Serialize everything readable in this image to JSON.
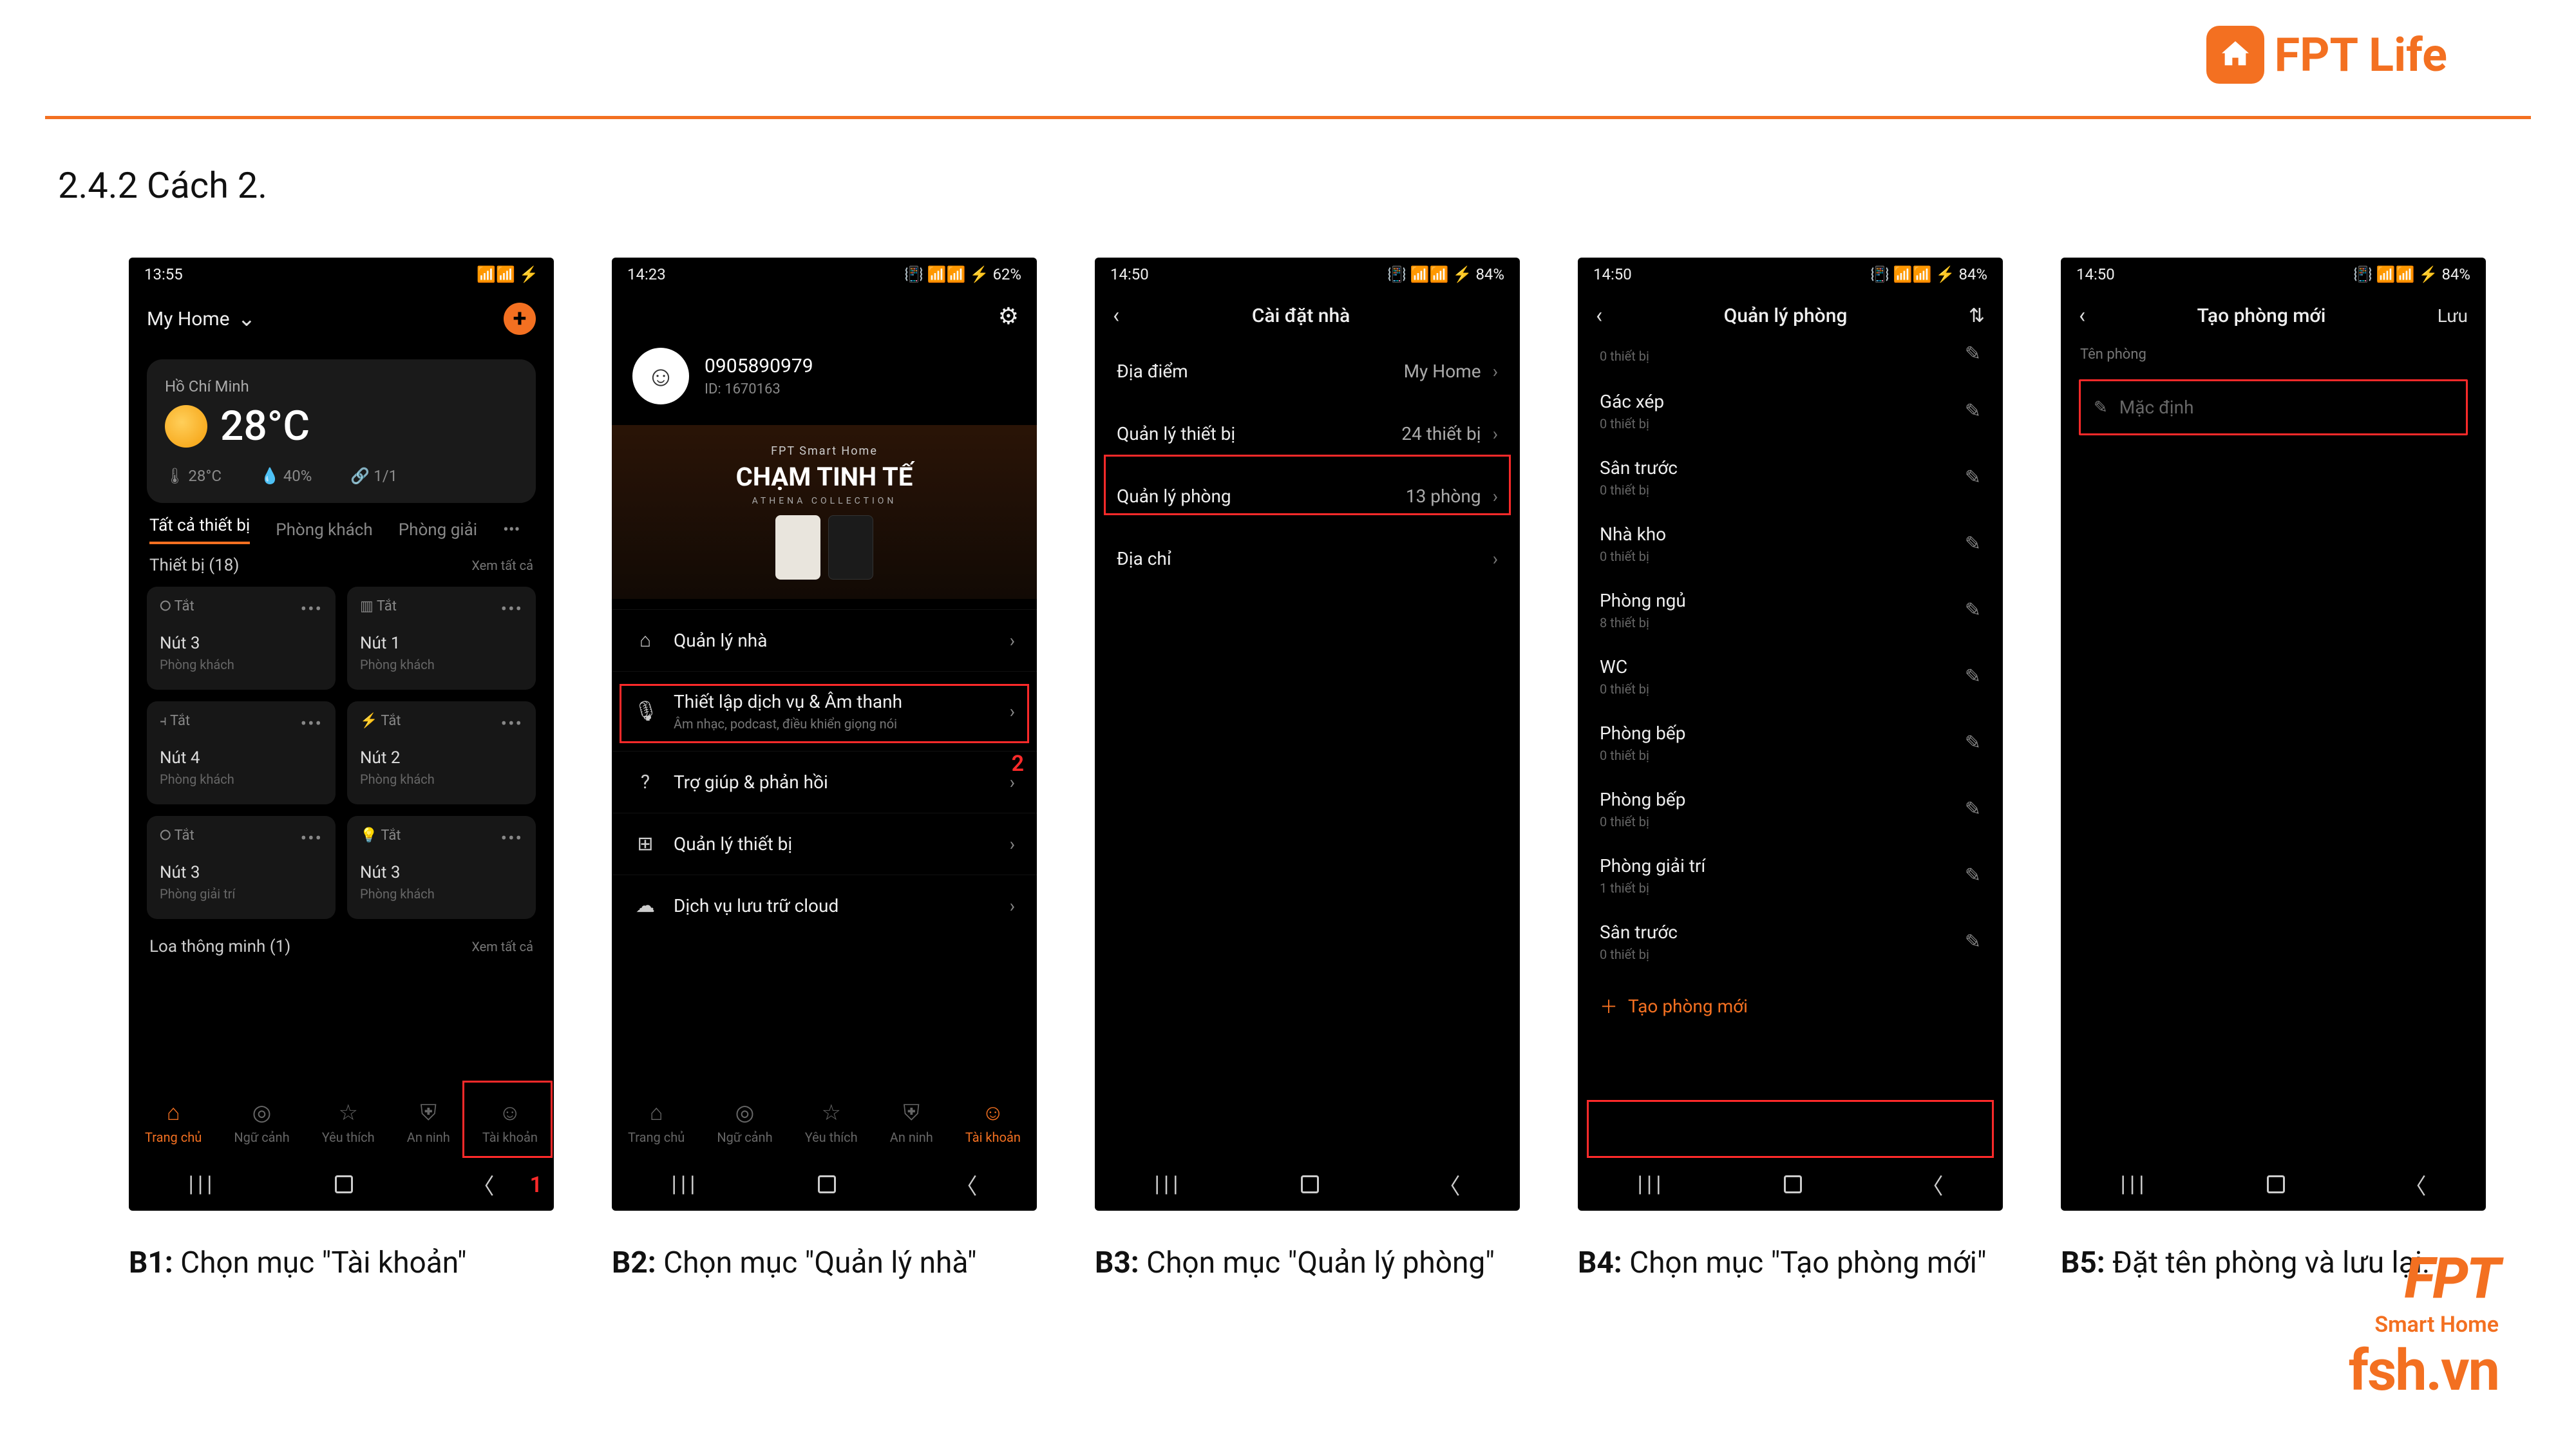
{
  "brand": {
    "name": "FPT Life"
  },
  "section": {
    "number": "2.4.2",
    "title": "Cách 2."
  },
  "footer_logo": {
    "line1": "FPT",
    "line2": "Smart Home",
    "line3": "fsh.vn"
  },
  "step_numbers": {
    "s1": "1",
    "s2": "2"
  },
  "captions": [
    {
      "bold": "B1:",
      "text": " Chọn mục \"Tài khoản\""
    },
    {
      "bold": "B2:",
      "text": " Chọn mục \"Quản lý nhà\""
    },
    {
      "bold": "B3:",
      "text": " Chọn mục \"Quản lý phòng\""
    },
    {
      "bold": "B4:",
      "text": " Chọn mục \"Tạo phòng mới\""
    },
    {
      "bold": "B5:",
      "text": " Đặt tên phòng và lưu lại."
    }
  ],
  "screen1": {
    "status": {
      "time": "13:55",
      "right": "📶📶 ⚡"
    },
    "home_label": "My Home",
    "weather": {
      "city": "Hồ Chí Minh",
      "temp": "28°C",
      "low": "🌡 28°C",
      "humid": "💧 40%",
      "pair": "🔗 1/1"
    },
    "tabs": {
      "all": "Tất cả thiết bị",
      "living": "Phòng khách",
      "ent": "Phòng giải"
    },
    "dev_header": {
      "label": "Thiết bị (18)",
      "more": "Xem tất cả"
    },
    "devs": [
      {
        "state": "Tắt",
        "name": "Nút 3",
        "room": "Phòng khách"
      },
      {
        "state": "Tắt",
        "name": "Nút 1",
        "room": "Phòng khách"
      },
      {
        "state": "Tắt",
        "name": "Nút 4",
        "room": "Phòng khách"
      },
      {
        "state": "Tắt",
        "name": "Nút 2",
        "room": "Phòng khách"
      },
      {
        "state": "Tắt",
        "name": "Nút 3",
        "room": "Phòng giải trí"
      },
      {
        "state": "Tắt",
        "name": "Nút 3",
        "room": "Phòng khách"
      }
    ],
    "speaker": {
      "label": "Loa thông minh (1)",
      "more": "Xem tất cả"
    },
    "nav": {
      "home": "Trang chủ",
      "scene": "Ngữ cảnh",
      "fav": "Yêu thích",
      "sec": "An ninh",
      "acct": "Tài khoản"
    }
  },
  "screen2": {
    "status": {
      "time": "14:23",
      "right": "📳 📶📶 ⚡ 62%"
    },
    "user": {
      "phone": "0905890979",
      "id": "ID: 1670163"
    },
    "banner": {
      "small": "FPT Smart Home",
      "big": "CHẠM TINH TẾ",
      "sub": "ATHENA COLLECTION"
    },
    "menu": {
      "home_mgmt": "Quản lý nhà",
      "audio": "Thiết lập dịch vụ & Âm thanh",
      "audio_sub": "Âm nhạc, podcast, điều khiển giọng nói",
      "help": "Trợ giúp & phản hồi",
      "dev_mgmt": "Quản lý thiết bị",
      "cloud": "Dịch vụ lưu trữ cloud"
    },
    "nav": {
      "home": "Trang chủ",
      "scene": "Ngữ cảnh",
      "fav": "Yêu thích",
      "sec": "An ninh",
      "acct": "Tài khoản"
    }
  },
  "screen3": {
    "status": {
      "time": "14:50",
      "right": "📳 📶📶 ⚡ 84%"
    },
    "title": "Cài đặt nhà",
    "rows": {
      "location": {
        "label": "Địa điểm",
        "value": "My Home"
      },
      "devices": {
        "label": "Quản lý thiết bị",
        "value": "24 thiết bị"
      },
      "rooms": {
        "label": "Quản lý phòng",
        "value": "13 phòng"
      },
      "address": {
        "label": "Địa chỉ",
        "value": ""
      }
    }
  },
  "screen4": {
    "status": {
      "time": "14:50",
      "right": "📳 📶📶 ⚡ 84%"
    },
    "title": "Quản lý phòng",
    "rooms": [
      {
        "name": "Gác xép",
        "sub": "0 thiết bị"
      },
      {
        "name": "Sân trước",
        "sub": "0 thiết bị"
      },
      {
        "name": "Nhà kho",
        "sub": "0 thiết bị"
      },
      {
        "name": "Phòng ngủ",
        "sub": "8 thiết bị"
      },
      {
        "name": "WC",
        "sub": "0 thiết bị"
      },
      {
        "name": "Phòng bếp",
        "sub": "0 thiết bị"
      },
      {
        "name": "Phòng bếp",
        "sub": "0 thiết bị"
      },
      {
        "name": "Phòng giải trí",
        "sub": "1 thiết bị"
      },
      {
        "name": "Sân trước",
        "sub": "0 thiết bị"
      }
    ],
    "top_sub": "0 thiết bị",
    "add": "Tạo phòng mới"
  },
  "screen5": {
    "status": {
      "time": "14:50",
      "right": "📳 📶📶 ⚡ 84%"
    },
    "title": "Tạo phòng mới",
    "save": "Lưu",
    "field_label": "Tên phòng",
    "placeholder": "Mặc định"
  }
}
